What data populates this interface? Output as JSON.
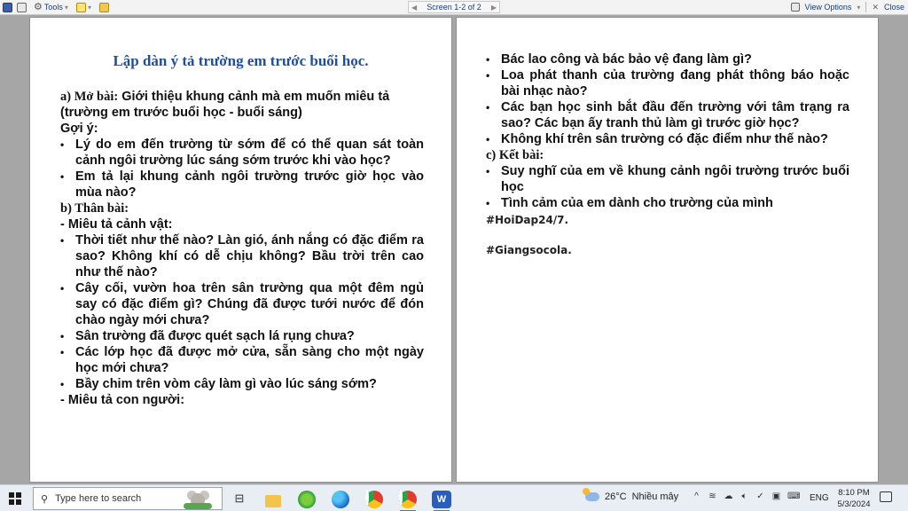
{
  "toolbar": {
    "tools_label": "Tools",
    "screen_label": "Screen 1-2 of 2",
    "view_options_label": "View Options",
    "close_label": "Close"
  },
  "doc": {
    "title": "Lập dàn ý tả trường em trước buổi học.",
    "open_label": "a) Mở bài:",
    "open_text": " Giới thiệu khung cảnh mà em muốn miêu tả (trường em trước buổi học - buổi sáng)",
    "hint_label": "Gợi ý:",
    "hint_items": [
      "Lý do em đến trường từ sớm để có thể quan sát toàn cảnh ngôi trường lúc sáng sớm trước khi vào học?",
      "Em tả lại khung cảnh ngôi trường trước giờ học vào mùa nào?"
    ],
    "body_label": "b) Thân bài:",
    "scene_label": "- Miêu tả cảnh vật:",
    "scene_items": [
      "Thời tiết như thế nào? Làn gió, ánh nắng có đặc điểm ra sao? Không khí có dễ chịu không? Bầu trời trên cao như thế nào?",
      "Cây cối, vườn hoa trên sân trường qua một đêm ngủ say có đặc điểm gì? Chúng đã được tưới nước để đón chào ngày mới chưa?",
      "Sân trường đã được quét sạch lá rụng chưa?",
      "Các lớp học đã được mở cửa, sẵn sàng cho một ngày học mới chưa?",
      "Bầy chim trên vòm cây làm gì vào lúc sáng sớm?"
    ],
    "people_label": "- Miêu tả con người:",
    "people_items": [
      "Bác lao công và bác bảo vệ đang làm gì?",
      "Loa phát thanh của trường đang phát thông báo hoặc bài nhạc nào?",
      "Các bạn học sinh bắt đầu đến trường với tâm trạng ra sao? Các bạn ấy tranh thủ làm gì trước giờ học?",
      "Không khí trên sân trường có đặc điểm như thế nào?"
    ],
    "end_label": "c) Kết bài:",
    "end_items": [
      "Suy nghĩ của em về khung cảnh ngôi trường trước buổi học",
      "Tình cảm của em dành cho trường của mình"
    ],
    "tag1": "#HoiDap24/7.",
    "tag2": "#Giangsocola."
  },
  "taskbar": {
    "search_placeholder": "Type here to search",
    "weather_temp": "26°C",
    "weather_desc": "Nhiều mây",
    "lang": "ENG",
    "time": "8:10 PM",
    "date": "5/3/2024"
  },
  "icons": [
    "save-icon",
    "print-icon",
    "tools-icon",
    "pen-icon",
    "folder-icon",
    "windows-start-icon",
    "search-icon",
    "task-view-icon",
    "file-explorer-icon",
    "edge-icon",
    "chrome-icon",
    "word-icon",
    "weather-icon",
    "notification-icon"
  ]
}
